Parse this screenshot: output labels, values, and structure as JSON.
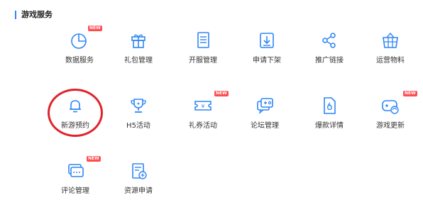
{
  "section": {
    "title": "游戏服务"
  },
  "badges": {
    "new": "NEW"
  },
  "tiles": {
    "shuju": {
      "label": "数据服务",
      "icon": "pie-chart-icon"
    },
    "libao": {
      "label": "礼包管理",
      "icon": "gift-icon"
    },
    "kaifu": {
      "label": "开服管理",
      "icon": "document-list-icon"
    },
    "xiajia": {
      "label": "申请下架",
      "icon": "download-box-icon"
    },
    "tuiguang": {
      "label": "推广链接",
      "icon": "share-icon"
    },
    "wuliao": {
      "label": "运营物料",
      "icon": "basket-icon"
    },
    "yuyue": {
      "label": "新游预约",
      "icon": "bell-icon"
    },
    "h5": {
      "label": "H5活动",
      "icon": "trophy-icon"
    },
    "liquan": {
      "label": "礼券活动",
      "icon": "coupon-icon"
    },
    "luntan": {
      "label": "论坛管理",
      "icon": "forum-chat-icon"
    },
    "baokuan": {
      "label": "爆款详情",
      "icon": "flame-document-icon"
    },
    "gengxin": {
      "label": "游戏更新",
      "icon": "gamepad-refresh-icon"
    },
    "pinglun": {
      "label": "评论管理",
      "icon": "comment-icon"
    },
    "ziyuan": {
      "label": "资源申请",
      "icon": "resource-doc-icon"
    }
  },
  "colors": {
    "accent": "#2f86f6",
    "badge": "#ff4d4f",
    "highlight_circle": "#e0232b"
  }
}
